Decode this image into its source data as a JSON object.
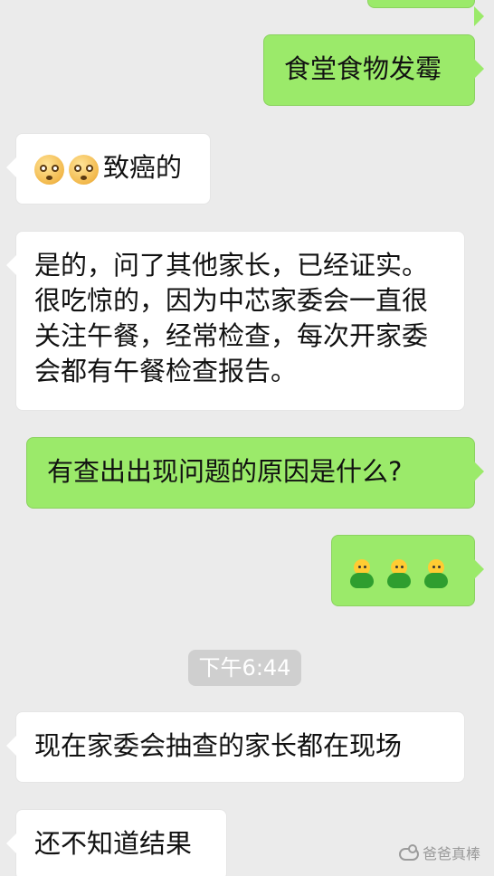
{
  "messages": [
    {
      "id": "m1",
      "sender": "me",
      "text": "食堂食物发霉"
    },
    {
      "id": "m2",
      "sender": "them",
      "emoji": [
        "shocked-face",
        "shocked-face"
      ],
      "text": "致癌的"
    },
    {
      "id": "m3",
      "sender": "them",
      "text": "是的，问了其他家长，已经证实。很吃惊的，因为中芯家委会一直很关注午餐，经常检查，每次开家委会都有午餐检查报告。"
    },
    {
      "id": "m4",
      "sender": "me",
      "text": "有查出出现问题的原因是什么?"
    },
    {
      "id": "m5",
      "sender": "me",
      "emoji": [
        "sprout-emoji",
        "sprout-emoji",
        "sprout-emoji"
      ]
    },
    {
      "id": "m6",
      "sender": "them",
      "text": "现在家委会抽查的家长都在现场"
    },
    {
      "id": "m7",
      "sender": "them",
      "text": "还不知道结果"
    }
  ],
  "timestamp": "下午6:44",
  "watermark": "爸爸真棒",
  "colors": {
    "background": "#ebebeb",
    "outgoing_bubble": "#9bea6a",
    "incoming_bubble": "#ffffff",
    "timestamp_bg": "#cfcfcf"
  }
}
